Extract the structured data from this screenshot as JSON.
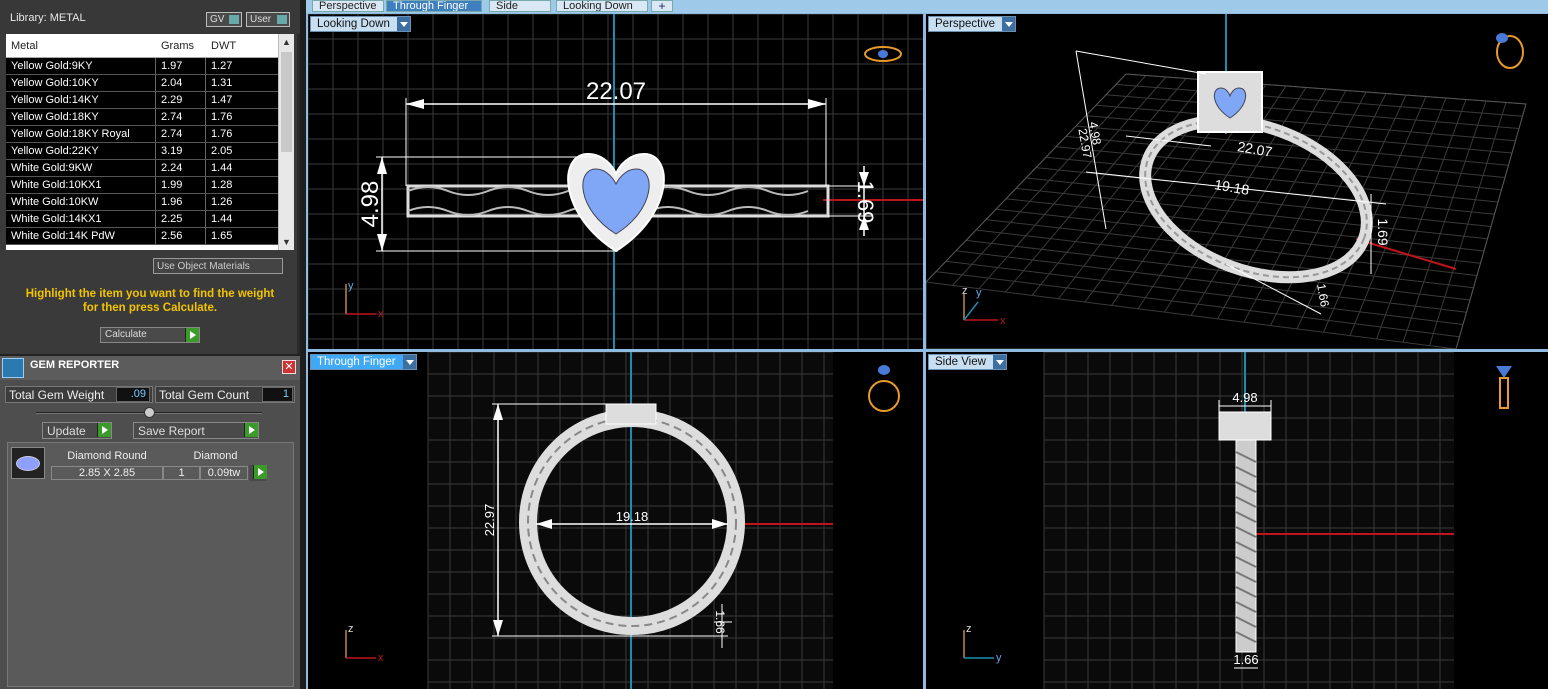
{
  "left_panel": {
    "library_label": "Library: METAL",
    "toggle_gv": "GV",
    "toggle_user": "User",
    "table": {
      "headers": [
        "Metal",
        "Grams",
        "DWT"
      ],
      "rows": [
        [
          "Yellow Gold:9KY",
          "1.97",
          "1.27"
        ],
        [
          "Yellow Gold:10KY",
          "2.04",
          "1.31"
        ],
        [
          "Yellow Gold:14KY",
          "2.29",
          "1.47"
        ],
        [
          "Yellow Gold:18KY",
          "2.74",
          "1.76"
        ],
        [
          "Yellow Gold:18KY Royal",
          "2.74",
          "1.76"
        ],
        [
          "Yellow Gold:22KY",
          "3.19",
          "2.05"
        ],
        [
          "White Gold:9KW",
          "2.24",
          "1.44"
        ],
        [
          "White Gold:10KX1",
          "1.99",
          "1.28"
        ],
        [
          "White Gold:10KW",
          "1.96",
          "1.26"
        ],
        [
          "White Gold:14KX1",
          "2.25",
          "1.44"
        ],
        [
          "White Gold:14K PdW",
          "2.56",
          "1.65"
        ]
      ]
    },
    "use_object_materials": "Use Object Materials",
    "hint_line1": "Highlight the item you want to find the weight",
    "hint_line2": "for then press Calculate.",
    "calculate_label": "Calculate"
  },
  "gem_reporter": {
    "title": "GEM REPORTER",
    "total_gem_weight_label": "Total Gem Weight",
    "total_gem_weight": ".09",
    "total_gem_count_label": "Total Gem Count",
    "total_gem_count": "1",
    "update_label": "Update",
    "save_report_label": "Save Report",
    "gems": [
      {
        "shape": "Diamond Round",
        "size": "2.85 X 2.85",
        "material": "Diamond",
        "count": "1",
        "weight": "0.09tw"
      }
    ]
  },
  "tabs": [
    "Perspective",
    "Through Finger",
    "Side View",
    "Looking Down"
  ],
  "active_tab": "Through Finger",
  "viewports": {
    "top_left": {
      "label": "Looking Down",
      "dims": {
        "length": "22.07",
        "height": "4.98",
        "band": "1.69"
      },
      "axis": [
        "y",
        "x"
      ]
    },
    "top_right": {
      "label": "Perspective",
      "dims": {
        "a": "22.07",
        "b": "19.18",
        "c": "22.97",
        "d": "4.98",
        "e": "1.69",
        "f": "1.66"
      },
      "axis": [
        "z",
        "y",
        "x"
      ]
    },
    "bottom_left": {
      "label": "Through Finger",
      "dims": {
        "width": "19.18",
        "height": "22.97",
        "band": "1.66"
      },
      "axis": [
        "z",
        "x"
      ]
    },
    "bottom_right": {
      "label": "Side View",
      "dims": {
        "top": "4.98",
        "bottom": "1.66"
      },
      "axis": [
        "z",
        "y"
      ]
    }
  },
  "colors": {
    "accent_blue": "#3fa9f5",
    "hint_yellow": "#f2c300",
    "axis_red": "#c0141c",
    "axis_cyan": "#1a8cb0",
    "gem_blue": "#7fa7f5"
  }
}
